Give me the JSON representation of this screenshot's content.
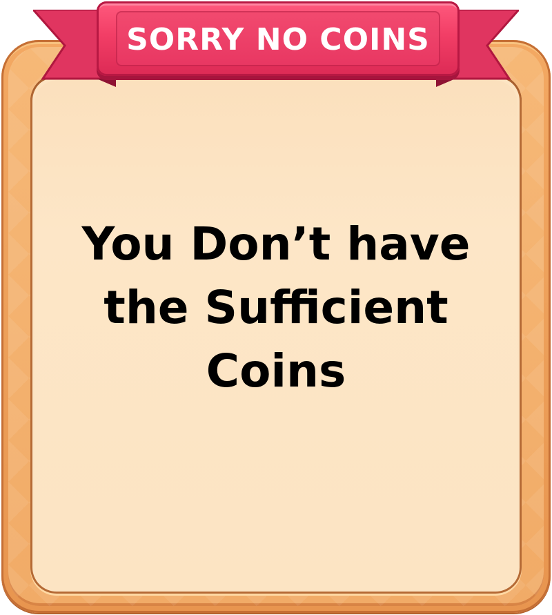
{
  "dialog": {
    "title": "SORRY NO COINS",
    "message_lines": [
      "You Don’t have",
      "the Sufficient",
      "Coins"
    ]
  },
  "colors": {
    "ribbon": "#f23e66",
    "frame": "#eea25c",
    "panel": "#fce4c3",
    "text": "#000000",
    "title_text": "#ffffff"
  }
}
